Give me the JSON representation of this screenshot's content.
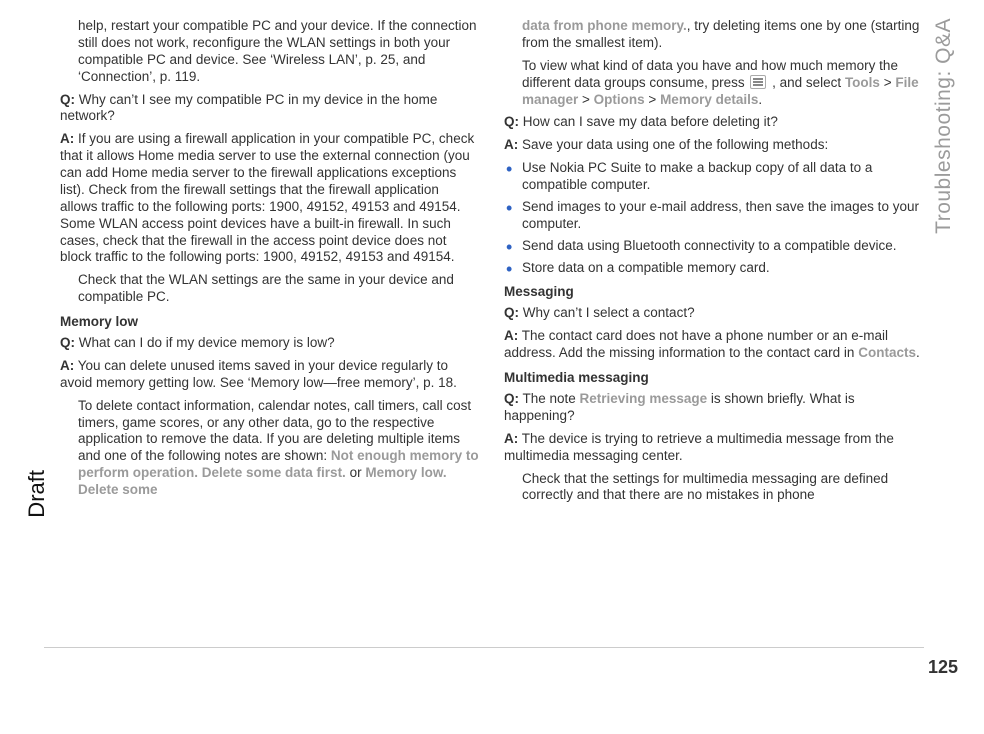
{
  "page_number": "125",
  "side_label": "Troubleshooting: Q&A",
  "draft_label": "Draft",
  "col1": {
    "p1_indent": "help, restart your compatible PC and your device. If the connection still does not work, reconfigure the WLAN settings in both your compatible PC and device. See ‘Wireless LAN’, p. 25, and ‘Connection’, p. 119.",
    "q1_label": "Q:",
    "q1": " Why can’t I see my compatible PC in my device in the home network?",
    "a1_label": "A:",
    "a1": " If you are using a firewall application in your compatible PC, check that it allows Home media server to use the external connection (you can add Home media server to the firewall applications exceptions list). Check from the firewall settings that the firewall application allows traffic to the following ports: 1900, 49152, 49153 and 49154. Some WLAN access point devices have a built-in firewall. In such cases, check that the firewall in the access point device does not block traffic to the following ports: 1900, 49152, 49153 and 49154.",
    "a1b": "Check that the WLAN settings are the same in your device and compatible PC.",
    "h1": "Memory low",
    "q2_label": "Q:",
    "q2": " What can I do if my device memory is low?",
    "a2_label": "A:",
    "a2_pre": " You can delete unused items saved in your device regularly to avoid memory getting low. See ‘Memory low—free memory’, p. 18.",
    "a2_mid": "To delete contact information, calendar notes, call timers, call cost timers, game scores, or any other data, go to the respective application to remove the data. If you are deleting multiple items and one of the following notes are shown: ",
    "a2_grey1": "Not enough memory to perform operation. Delete some data first.",
    "a2_or": " or ",
    "a2_grey2": "Memory low. Delete some"
  },
  "col2": {
    "p1_grey": "data from phone memory.",
    "p1_rest": ", try deleting items one by one (starting from the smallest item).",
    "p2a": "To view what kind of data you have and how much memory the different data groups consume, press ",
    "p2b": " , and select ",
    "tools": "Tools",
    "filemgr": "File manager",
    "options": "Options",
    "memdet": "Memory details",
    "gt": " > ",
    "period": ".",
    "q3_label": "Q:",
    "q3": " How can I save my data before deleting it?",
    "a3_label": "A:",
    "a3": " Save your data using one of the following methods:",
    "b1": "Use Nokia PC Suite to make a backup copy of all data to a compatible computer.",
    "b2": "Send images to your e-mail address, then save the images to your computer.",
    "b3": "Send data using Bluetooth connectivity to a compatible device.",
    "b4": "Store data on a compatible memory card.",
    "h2": "Messaging",
    "q4_label": "Q:",
    "q4": " Why can’t I select a contact?",
    "a4_label": "A:",
    "a4a": " The contact card does not have a phone number or an e-mail address. Add the missing information to the contact card in ",
    "a4_grey": "Contacts",
    "h3": "Multimedia messaging",
    "q5_label": "Q:",
    "q5a": " The note ",
    "q5_grey": "Retrieving message",
    "q5b": " is shown briefly. What is happening?",
    "a5_label": "A:",
    "a5a": " The device is trying to retrieve a multimedia message from the multimedia messaging center.",
    "a5b": "Check that the settings for multimedia messaging are defined correctly and that there are no mistakes in phone"
  }
}
